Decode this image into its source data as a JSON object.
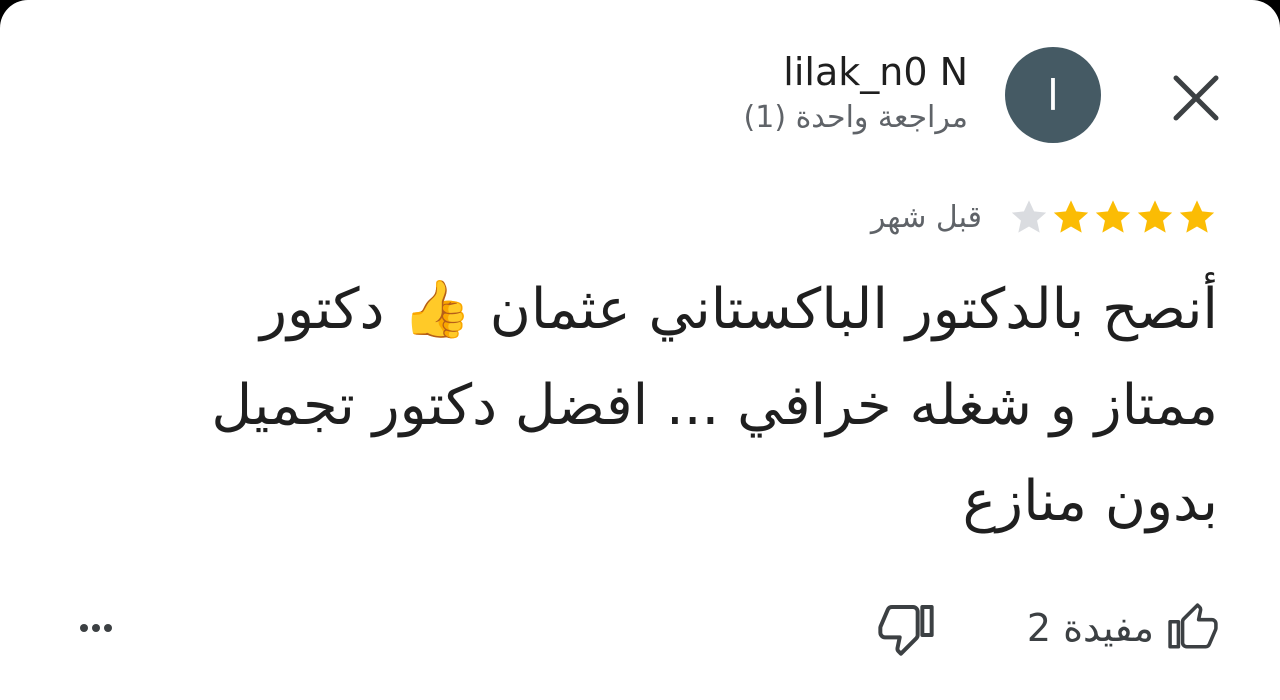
{
  "header": {
    "user_name": "lilak_n0 N",
    "avatar_initial": "l",
    "review_count": "مراجعة واحدة (1)"
  },
  "rating": {
    "stars": 4,
    "max_stars": 5,
    "time_ago": "قبل شهر"
  },
  "review": {
    "text": "أنصح بالدكتور الباكستاني عثمان 👍 دكتور ممتاز و شغله خرافي ... افضل دكتور تجميل بدون منازع"
  },
  "actions": {
    "helpful_label": "مفيدة 2"
  },
  "icons": {
    "close": "close-icon",
    "star": "star-icon",
    "thumbs_up": "thumbs-up-icon",
    "thumbs_down": "thumbs-down-icon",
    "more": "more-horizontal-icon"
  },
  "colors": {
    "avatar_bg": "#455a64",
    "star_filled": "#fbbc04",
    "star_empty": "#dadce0",
    "text_primary": "#1f1f1f",
    "text_secondary": "#5f6368",
    "icon": "#3c4043"
  }
}
